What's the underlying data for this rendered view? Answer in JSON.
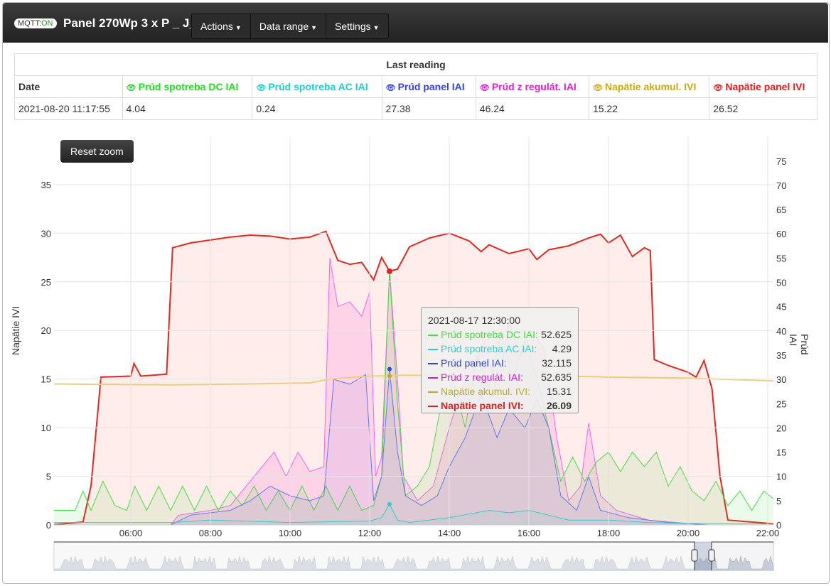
{
  "header": {
    "mqtt_label": "MQTT:",
    "mqtt_state": "ON",
    "title": "Panel 270Wp 3 x P _ J_",
    "menus": [
      "Actions",
      "Data range",
      "Settings"
    ]
  },
  "table": {
    "caption": "Last reading",
    "columns": [
      {
        "label": "Date",
        "color": "#333"
      },
      {
        "label": "Prúd spotreba DC IAI",
        "color": "#22dd22"
      },
      {
        "label": "Prúd spotreba AC IAI",
        "color": "#22cccc"
      },
      {
        "label": "Prúd panel IAI",
        "color": "#3344dd"
      },
      {
        "label": "Prúd z regulát. IAI",
        "color": "#dd22cc"
      },
      {
        "label": "Napätie akumul. IVI",
        "color": "#c8aa10"
      },
      {
        "label": "Napätie panel IVI",
        "color": "#e02020"
      }
    ],
    "values": [
      "2021-08-20 11:17:55",
      "4.04",
      "0.24",
      "27.38",
      "46.24",
      "15.22",
      "26.52"
    ]
  },
  "reset_zoom": "Reset zoom",
  "tooltip": {
    "time": "2021-08-17 12:30:00",
    "rows": [
      {
        "label": "Prúd spotreba DC IAI:",
        "value": "52.625",
        "color": "#44dd44"
      },
      {
        "label": "Prúd spotreba AC IAI:",
        "value": "4.29",
        "color": "#33cccc"
      },
      {
        "label": "Prúd panel IAI:",
        "value": "32.115",
        "color": "#3344cc"
      },
      {
        "label": "Prúd z regulát. IAI:",
        "value": "52.635",
        "color": "#cc22cc"
      },
      {
        "label": "Napätie akumul. IVI:",
        "value": "15.31",
        "color": "#bbaa33"
      },
      {
        "label": "Napätie panel IVI:",
        "value": "26.09",
        "color": "#dd2222",
        "bold": true
      }
    ]
  },
  "chart_data": {
    "type": "line",
    "xlabel": "",
    "ylabel": "Napätie IVI",
    "y2label": "Prúd IAI",
    "xlim": [
      4.07,
      22.14
    ],
    "ylim": [
      0,
      37.5
    ],
    "y2lim": [
      0,
      80
    ],
    "xticks": [
      "06:00",
      "08:00",
      "10:00",
      "12:00",
      "14:00",
      "16:00",
      "18:00",
      "20:00",
      "22:00"
    ],
    "yticks": [
      0,
      5,
      10,
      15,
      20,
      25,
      30,
      35
    ],
    "y2ticks": [
      0,
      5,
      10,
      15,
      20,
      25,
      30,
      35,
      40,
      45,
      50,
      55,
      60,
      65,
      70,
      75
    ],
    "series": [
      {
        "name": "Prúd spotreba DC IAI",
        "axis": "right",
        "color": "#44dd44",
        "fill": "rgba(60,220,60,0.10)",
        "points": [
          [
            4,
            3
          ],
          [
            4.3,
            3
          ],
          [
            4.6,
            3
          ],
          [
            4.8,
            7
          ],
          [
            5,
            3
          ],
          [
            5.3,
            9
          ],
          [
            5.6,
            4
          ],
          [
            5.9,
            3
          ],
          [
            6.1,
            8
          ],
          [
            6.4,
            3
          ],
          [
            6.7,
            8
          ],
          [
            7,
            3
          ],
          [
            7.3,
            8
          ],
          [
            7.6,
            3
          ],
          [
            7.9,
            8
          ],
          [
            8.2,
            3
          ],
          [
            8.5,
            7
          ],
          [
            8.8,
            4
          ],
          [
            9.1,
            8
          ],
          [
            9.4,
            3
          ],
          [
            9.7,
            7
          ],
          [
            10,
            3
          ],
          [
            10.3,
            8
          ],
          [
            10.6,
            3
          ],
          [
            10.9,
            8
          ],
          [
            11.2,
            3
          ],
          [
            11.5,
            8
          ],
          [
            11.8,
            3
          ],
          [
            12.1,
            4
          ],
          [
            12.3,
            10
          ],
          [
            12.5,
            52.6
          ],
          [
            12.7,
            25
          ],
          [
            12.9,
            6
          ],
          [
            13.2,
            8
          ],
          [
            13.5,
            12
          ],
          [
            13.8,
            25
          ],
          [
            14.1,
            30
          ],
          [
            14.4,
            20
          ],
          [
            14.7,
            35
          ],
          [
            15,
            28
          ],
          [
            15.3,
            40
          ],
          [
            15.6,
            30
          ],
          [
            15.9,
            38
          ],
          [
            16.2,
            30
          ],
          [
            16.5,
            20
          ],
          [
            16.8,
            9
          ],
          [
            17.1,
            14
          ],
          [
            17.4,
            9
          ],
          [
            17.7,
            13
          ],
          [
            18,
            15
          ],
          [
            18.3,
            11
          ],
          [
            18.6,
            15
          ],
          [
            18.9,
            12
          ],
          [
            19.2,
            15
          ],
          [
            19.5,
            8
          ],
          [
            19.8,
            12
          ],
          [
            20.1,
            7
          ],
          [
            20.4,
            5
          ],
          [
            20.7,
            9
          ],
          [
            21,
            4
          ],
          [
            21.3,
            7
          ],
          [
            21.6,
            3
          ],
          [
            21.9,
            7
          ],
          [
            22.2,
            5
          ]
        ]
      },
      {
        "name": "Prúd spotreba AC IAI",
        "axis": "right",
        "color": "#33cccc",
        "fill": "rgba(50,200,200,0.08)",
        "points": [
          [
            4,
            0.5
          ],
          [
            7,
            0.5
          ],
          [
            8,
            1
          ],
          [
            10,
            0.5
          ],
          [
            12,
            0.8
          ],
          [
            12.3,
            1.5
          ],
          [
            12.5,
            4.3
          ],
          [
            12.7,
            1
          ],
          [
            13,
            0.5
          ],
          [
            14,
            1.5
          ],
          [
            15,
            3
          ],
          [
            15.5,
            2.5
          ],
          [
            16,
            3
          ],
          [
            16.5,
            2
          ],
          [
            17,
            1
          ],
          [
            18,
            1
          ],
          [
            19,
            0.5
          ],
          [
            20,
            0.3
          ],
          [
            22.2,
            0.2
          ]
        ]
      },
      {
        "name": "Prúd panel IAI",
        "axis": "right",
        "color": "#6677ee",
        "fill": "rgba(80,90,230,0.08)",
        "points": [
          [
            4,
            0
          ],
          [
            7,
            0
          ],
          [
            7.5,
            2
          ],
          [
            8.5,
            3
          ],
          [
            9,
            5
          ],
          [
            9.5,
            8
          ],
          [
            10,
            6
          ],
          [
            10.5,
            5
          ],
          [
            10.85,
            6
          ],
          [
            11.1,
            30
          ],
          [
            11.5,
            29
          ],
          [
            11.9,
            31
          ],
          [
            12.1,
            5
          ],
          [
            12.3,
            10
          ],
          [
            12.5,
            32.1
          ],
          [
            12.7,
            15
          ],
          [
            12.9,
            6
          ],
          [
            13.3,
            4
          ],
          [
            13.7,
            6
          ],
          [
            14,
            12
          ],
          [
            14.4,
            18
          ],
          [
            14.8,
            27
          ],
          [
            15.2,
            18
          ],
          [
            15.5,
            24
          ],
          [
            15.9,
            20
          ],
          [
            16.2,
            26
          ],
          [
            16.5,
            20
          ],
          [
            16.8,
            6
          ],
          [
            17.2,
            3
          ],
          [
            17.5,
            10
          ],
          [
            17.8,
            3
          ],
          [
            18.5,
            1.5
          ],
          [
            19.5,
            0.5
          ],
          [
            20.5,
            0
          ],
          [
            22.2,
            0
          ]
        ]
      },
      {
        "name": "Prúd z regulát. IAI",
        "axis": "right",
        "color": "#ee66ee",
        "fill": "rgba(240,60,200,0.14)",
        "points": [
          [
            4,
            0
          ],
          [
            7,
            0
          ],
          [
            7.2,
            2
          ],
          [
            8,
            3
          ],
          [
            8.5,
            4
          ],
          [
            9,
            9
          ],
          [
            9.3,
            12
          ],
          [
            9.6,
            15
          ],
          [
            9.9,
            10
          ],
          [
            10.2,
            15
          ],
          [
            10.5,
            11
          ],
          [
            10.85,
            12
          ],
          [
            11,
            55
          ],
          [
            11.2,
            45
          ],
          [
            11.5,
            46
          ],
          [
            11.8,
            43
          ],
          [
            12,
            48
          ],
          [
            12.15,
            10
          ],
          [
            12.3,
            14
          ],
          [
            12.5,
            52.6
          ],
          [
            12.7,
            30
          ],
          [
            12.85,
            10
          ],
          [
            13.2,
            5
          ],
          [
            13.6,
            8
          ],
          [
            14,
            20
          ],
          [
            14.3,
            28
          ],
          [
            14.6,
            32
          ],
          [
            14.9,
            38
          ],
          [
            15.2,
            27
          ],
          [
            15.5,
            42
          ],
          [
            15.8,
            35
          ],
          [
            16.1,
            40
          ],
          [
            16.4,
            36
          ],
          [
            16.7,
            18
          ],
          [
            17,
            5
          ],
          [
            17.3,
            8
          ],
          [
            17.5,
            21
          ],
          [
            17.8,
            6
          ],
          [
            18.2,
            3
          ],
          [
            19,
            1
          ],
          [
            20,
            0.3
          ],
          [
            20.5,
            0
          ],
          [
            22.2,
            0
          ]
        ]
      },
      {
        "name": "Napätie akumul. IVI",
        "axis": "left",
        "color": "#e8d080",
        "fill": "none",
        "points": [
          [
            4,
            14.5
          ],
          [
            7,
            14.4
          ],
          [
            9,
            14.5
          ],
          [
            10.5,
            14.6
          ],
          [
            11,
            15
          ],
          [
            12,
            15.3
          ],
          [
            13,
            15.4
          ],
          [
            15,
            15.3
          ],
          [
            17,
            15.3
          ],
          [
            18,
            15.2
          ],
          [
            20,
            15.1
          ],
          [
            22.2,
            14.8
          ]
        ]
      },
      {
        "name": "Napätie panel IVI",
        "axis": "left",
        "color": "#e02a20",
        "fill": "rgba(255,80,60,0.10)",
        "points": [
          [
            4,
            0
          ],
          [
            4.8,
            0.3
          ],
          [
            5,
            4
          ],
          [
            5.25,
            15.2
          ],
          [
            6,
            15.3
          ],
          [
            6.08,
            16.6
          ],
          [
            6.25,
            15.3
          ],
          [
            6.9,
            15.5
          ],
          [
            7.05,
            28.5
          ],
          [
            7.5,
            29
          ],
          [
            8,
            29.3
          ],
          [
            8.5,
            29.6
          ],
          [
            9,
            29.8
          ],
          [
            9.5,
            29.7
          ],
          [
            10,
            29.4
          ],
          [
            10.5,
            29.6
          ],
          [
            10.9,
            30.2
          ],
          [
            11.2,
            27.2
          ],
          [
            11.5,
            26.8
          ],
          [
            11.8,
            27
          ],
          [
            12.1,
            25.2
          ],
          [
            12.3,
            27.5
          ],
          [
            12.5,
            26.1
          ],
          [
            12.7,
            26.3
          ],
          [
            13,
            28.6
          ],
          [
            13.5,
            29.5
          ],
          [
            14,
            30
          ],
          [
            14.5,
            29.2
          ],
          [
            14.8,
            28.1
          ],
          [
            15,
            28.8
          ],
          [
            15.5,
            27.9
          ],
          [
            16,
            28.4
          ],
          [
            16.2,
            27.3
          ],
          [
            16.5,
            28.3
          ],
          [
            17,
            28.7
          ],
          [
            17.5,
            29.5
          ],
          [
            17.8,
            29.9
          ],
          [
            18,
            29
          ],
          [
            18.3,
            29.8
          ],
          [
            18.6,
            27.6
          ],
          [
            18.9,
            28.5
          ],
          [
            19.05,
            28.2
          ],
          [
            19.15,
            17
          ],
          [
            19.5,
            16.4
          ],
          [
            20,
            15.7
          ],
          [
            20.2,
            15.2
          ],
          [
            20.4,
            16.9
          ],
          [
            20.6,
            14
          ],
          [
            20.8,
            5
          ],
          [
            21,
            0.5
          ],
          [
            22.2,
            0.1
          ]
        ]
      }
    ]
  }
}
